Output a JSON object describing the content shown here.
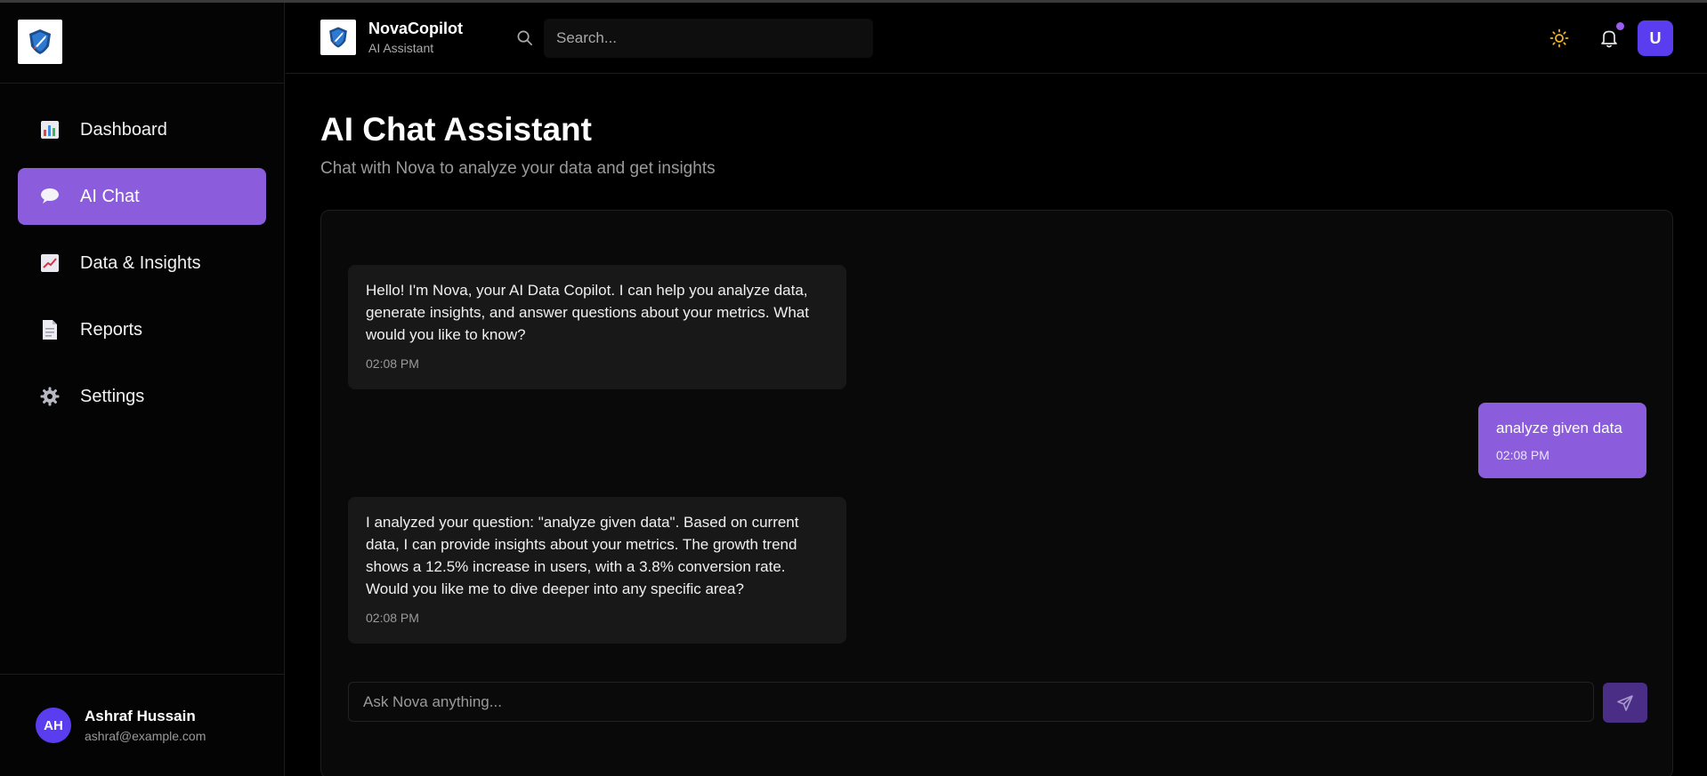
{
  "sidebar": {
    "items": [
      {
        "label": "Dashboard",
        "icon": "bar-chart-icon"
      },
      {
        "label": "AI Chat",
        "icon": "speech-bubble-icon"
      },
      {
        "label": "Data & Insights",
        "icon": "trend-chart-icon"
      },
      {
        "label": "Reports",
        "icon": "document-icon"
      },
      {
        "label": "Settings",
        "icon": "gear-icon"
      }
    ],
    "active_index": 1,
    "user": {
      "initials": "AH",
      "name": "Ashraf Hussain",
      "email": "ashraf@example.com"
    }
  },
  "header": {
    "app_name": "NovaCopilot",
    "app_subtitle": "AI Assistant",
    "search_placeholder": "Search...",
    "user_initial": "U"
  },
  "main": {
    "title": "AI Chat Assistant",
    "subtitle": "Chat with Nova to analyze your data and get insights",
    "messages": [
      {
        "role": "assistant",
        "text": "Hello! I'm Nova, your AI Data Copilot. I can help you analyze data, generate insights, and answer questions about your metrics. What would you like to know?",
        "time": "02:08 PM"
      },
      {
        "role": "user",
        "text": "analyze given data",
        "time": "02:08 PM"
      },
      {
        "role": "assistant",
        "text": "I analyzed your question: \"analyze given data\". Based on current data, I can provide insights about your metrics. The growth trend shows a 12.5% increase in users, with a 3.8% conversion rate. Would you like me to dive deeper into any specific area?",
        "time": "02:08 PM"
      }
    ],
    "input_placeholder": "Ask Nova anything..."
  },
  "colors": {
    "accent": "#8b5cdc",
    "avatar": "#5b3df0",
    "background": "#000000",
    "bubble_ai": "#181818",
    "sun": "#f0b429"
  }
}
